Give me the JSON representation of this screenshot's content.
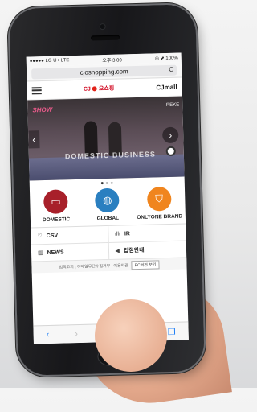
{
  "status": {
    "carrier": "●●●●● LG U+  LTE",
    "time": "오후 3:00",
    "battery": "◎ ⬈ 100%"
  },
  "browser": {
    "url": "cjoshopping.com",
    "reload_icon": "C"
  },
  "site": {
    "logo_text": "오쇼핑",
    "logo_badge": "CJ",
    "mall_text": "CJmall"
  },
  "banner": {
    "brand": "SHOW",
    "brand_right": "REKE",
    "caption": "DOMESTIC BUSINESS"
  },
  "categories": [
    {
      "label": "DOMESTIC",
      "icon": "monitor-icon",
      "color": "#a8202a"
    },
    {
      "label": "GLOBAL",
      "icon": "globe-icon",
      "color": "#2a7fc0"
    },
    {
      "label": "ONLYONE BRAND",
      "icon": "bag-icon",
      "color": "#f0851e"
    }
  ],
  "links": [
    {
      "label": "CSV",
      "icon": "heart-icon"
    },
    {
      "label": "IR",
      "icon": "chart-icon"
    },
    {
      "label": "NEWS",
      "icon": "news-icon"
    },
    {
      "label": "입점안내",
      "icon": "megaphone-icon"
    }
  ],
  "footer": {
    "items": "법적고지 | 이메일무단수집거부 | 이용약관",
    "pc_button": "PC버전 보기"
  },
  "toolbar": {
    "back": "‹",
    "forward": "›",
    "share": "⇪",
    "bookmarks": "⌷",
    "tabs": "❐"
  }
}
